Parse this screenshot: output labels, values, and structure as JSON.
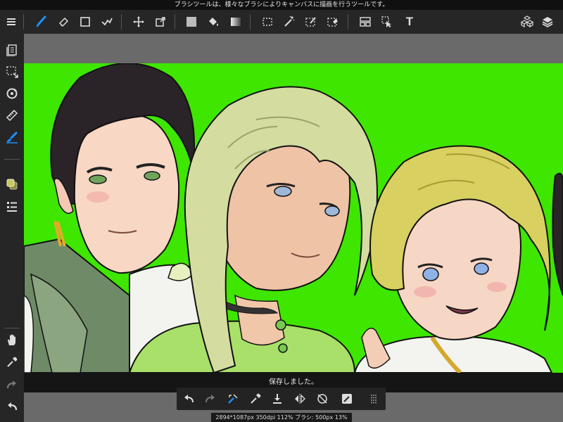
{
  "tooltip": "ブラシツールは、様々なブラシによりキャンバスに描画を行うツールです。",
  "toolbar": {
    "text_tool_label": "T",
    "icons": [
      "menu-icon",
      "brush-icon",
      "eraser-icon",
      "rectangle-icon",
      "correction-icon",
      "move-icon",
      "transform-icon",
      "fill-color-icon",
      "bucket-icon",
      "gradient-icon",
      "select-rect-icon",
      "magic-wand-icon",
      "select-pen-icon",
      "select-eraser-icon",
      "panel-icon",
      "operation-icon",
      "text-icon",
      "3d-icon",
      "layers-icon"
    ]
  },
  "left_toolbar": {
    "icons": [
      "page-icon",
      "select-area-icon",
      "rotate-icon",
      "ruler-icon",
      "snap-icon",
      "color-icon",
      "brush-list-icon",
      "hand-icon",
      "eyedropper-icon",
      "redo-icon",
      "undo-icon"
    ]
  },
  "toast": {
    "message": "保存しました。"
  },
  "quick_bar": {
    "icons": [
      "undo-icon",
      "redo-icon",
      "transform-icon",
      "eyedropper-icon",
      "import-icon",
      "flip-icon",
      "no-snap-icon",
      "filter-icon",
      "grip-icon"
    ]
  },
  "status": {
    "text": "2894*1087px 350dpi 112% ブラシ: 500px 13%"
  },
  "colors": {
    "canvas_bg": "#3ee600",
    "toolbar_bg": "#262626",
    "accent": "#1e90ff"
  }
}
